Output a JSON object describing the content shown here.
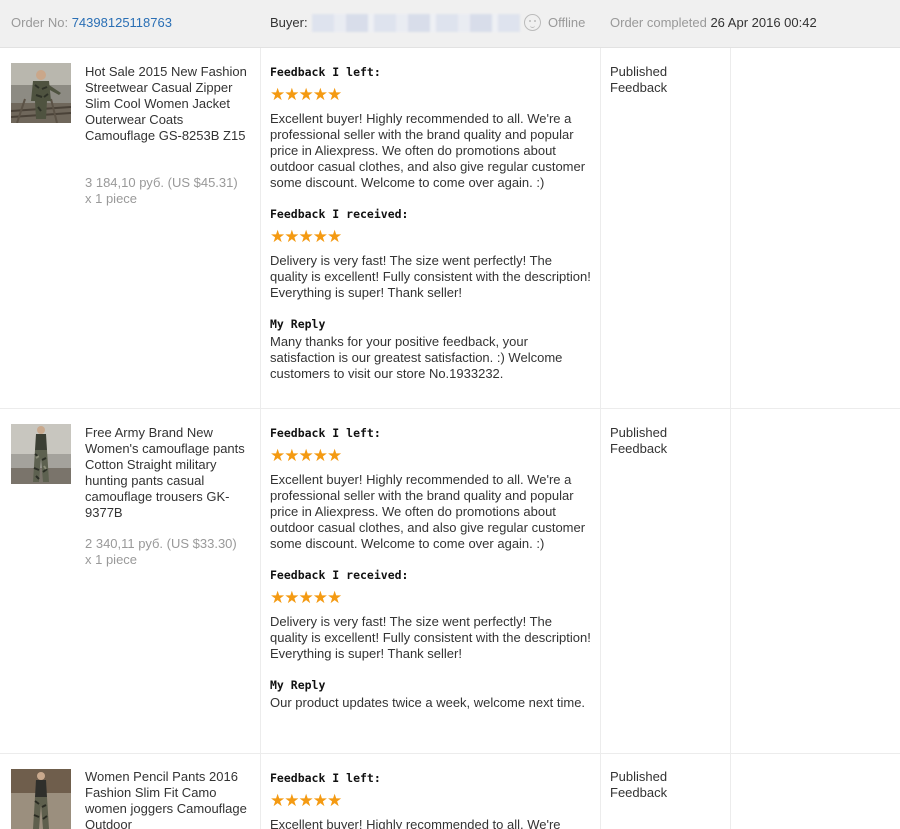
{
  "header": {
    "order_label": "Order No:",
    "order_number": "74398125118763",
    "buyer_label": "Buyer:",
    "buyer_status": "Offline",
    "completed_label": "Order completed",
    "completed_date": "26 Apr 2016 00:42"
  },
  "orders": [
    {
      "title": "Hot Sale 2015 New Fashion Streetwear Casual Zipper Slim Cool Women Jacket Outerwear Coats Camouflage GS-8253B Z15",
      "price": "3 184,10 руб. (US $45.31)",
      "qty": "x 1 piece",
      "feedback_left_label": "Feedback I left:",
      "feedback_left_stars": "★★★★★",
      "feedback_left_text": "Excellent buyer! Highly recommended to all. We're a professional seller with the brand quality and popular price in Aliexpress. We often do promotions about outdoor casual clothes, and also give regular customer some discount. Welcome to come over again. :)",
      "feedback_received_label": "Feedback I received:",
      "feedback_received_stars": "★★★★★",
      "feedback_received_text": "Delivery is very fast! The size went perfectly! The quality is excellent! Fully consistent with the description! Everything is super! Thank seller!",
      "reply_label": "My Reply",
      "reply_text": "Many thanks for your positive feedback, your satisfaction is our greatest satisfaction. :) Welcome customers to visit our store No.1933232.",
      "status": "Published Feedback"
    },
    {
      "title": "Free Army Brand New Women's camouflage pants Cotton Straight military hunting pants casual camouflage trousers GK-9377B",
      "price": "2 340,11 руб. (US $33.30)",
      "qty": "x 1 piece",
      "feedback_left_label": "Feedback I left:",
      "feedback_left_stars": "★★★★★",
      "feedback_left_text": "Excellent buyer! Highly recommended to all. We're a professional seller with the brand quality and popular price in Aliexpress. We often do promotions about outdoor casual clothes, and also give regular customer some discount. Welcome to come over again. :)",
      "feedback_received_label": "Feedback I received:",
      "feedback_received_stars": "★★★★★",
      "feedback_received_text": "Delivery is very fast! The size went perfectly! The quality is excellent! Fully consistent with the description! Everything is super! Thank seller!",
      "reply_label": "My Reply",
      "reply_text": "Our product updates twice a week, welcome next time.",
      "status": "Published Feedback"
    },
    {
      "title": "Women Pencil Pants 2016 Fashion Slim Fit Camo women joggers Camouflage Outdoor",
      "feedback_left_label": "Feedback I left:",
      "feedback_left_stars": "★★★★★",
      "feedback_left_text": "Excellent buyer! Highly recommended to all. We're",
      "status": "Published Feedback"
    }
  ],
  "colors": {
    "accent_link": "#2a6fb5",
    "star": "#f49a12",
    "header_bg": "#f0f0f0",
    "muted": "#999999"
  }
}
